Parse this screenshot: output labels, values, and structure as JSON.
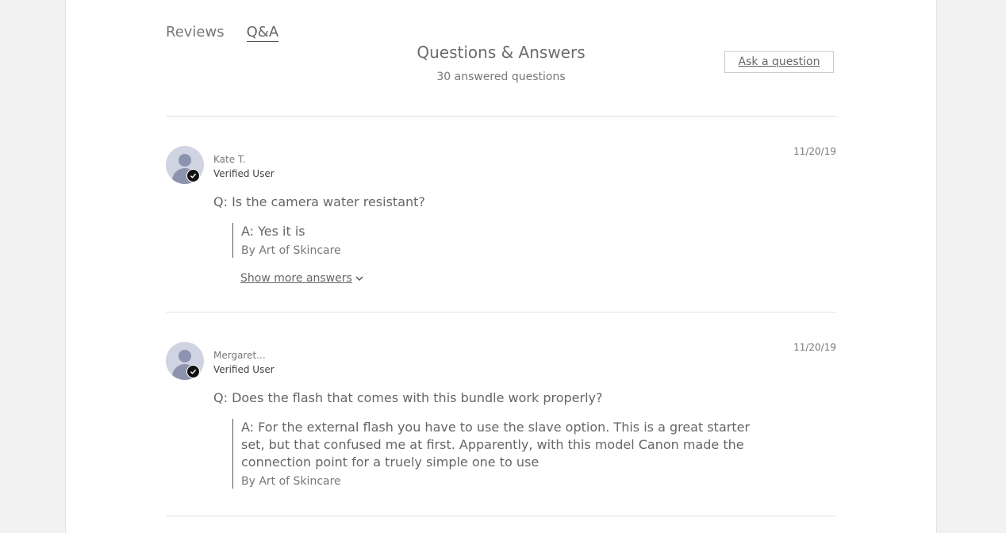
{
  "tabs": {
    "reviews": "Reviews",
    "qa": "Q&A"
  },
  "header": {
    "title": "Questions & Answers",
    "subtitle": "30 answered questions",
    "ask_button": "Ask a question"
  },
  "questions": [
    {
      "user_name": "Kate T.",
      "user_status": "Verified User",
      "date": "11/20/19",
      "question": "Q: Is the camera water resistant?",
      "answer": "A: Yes it is",
      "answer_by": "By Art of Skincare",
      "show_more": "Show more answers"
    },
    {
      "user_name": "Mergaret...",
      "user_status": "Verified User",
      "date": "11/20/19",
      "question": "Q: Does the flash that comes with this bundle work properly?",
      "answer": "A: For the external flash you have to use the slave option. This is a great starter set, but that confused me at first. Apparently, with this model Canon made the connection point for a truely simple one to use",
      "answer_by": "By Art of Skincare"
    }
  ],
  "icons": {
    "avatar": "user-avatar-icon",
    "verified": "check-circle-icon",
    "chevron": "chevron-down-icon"
  }
}
